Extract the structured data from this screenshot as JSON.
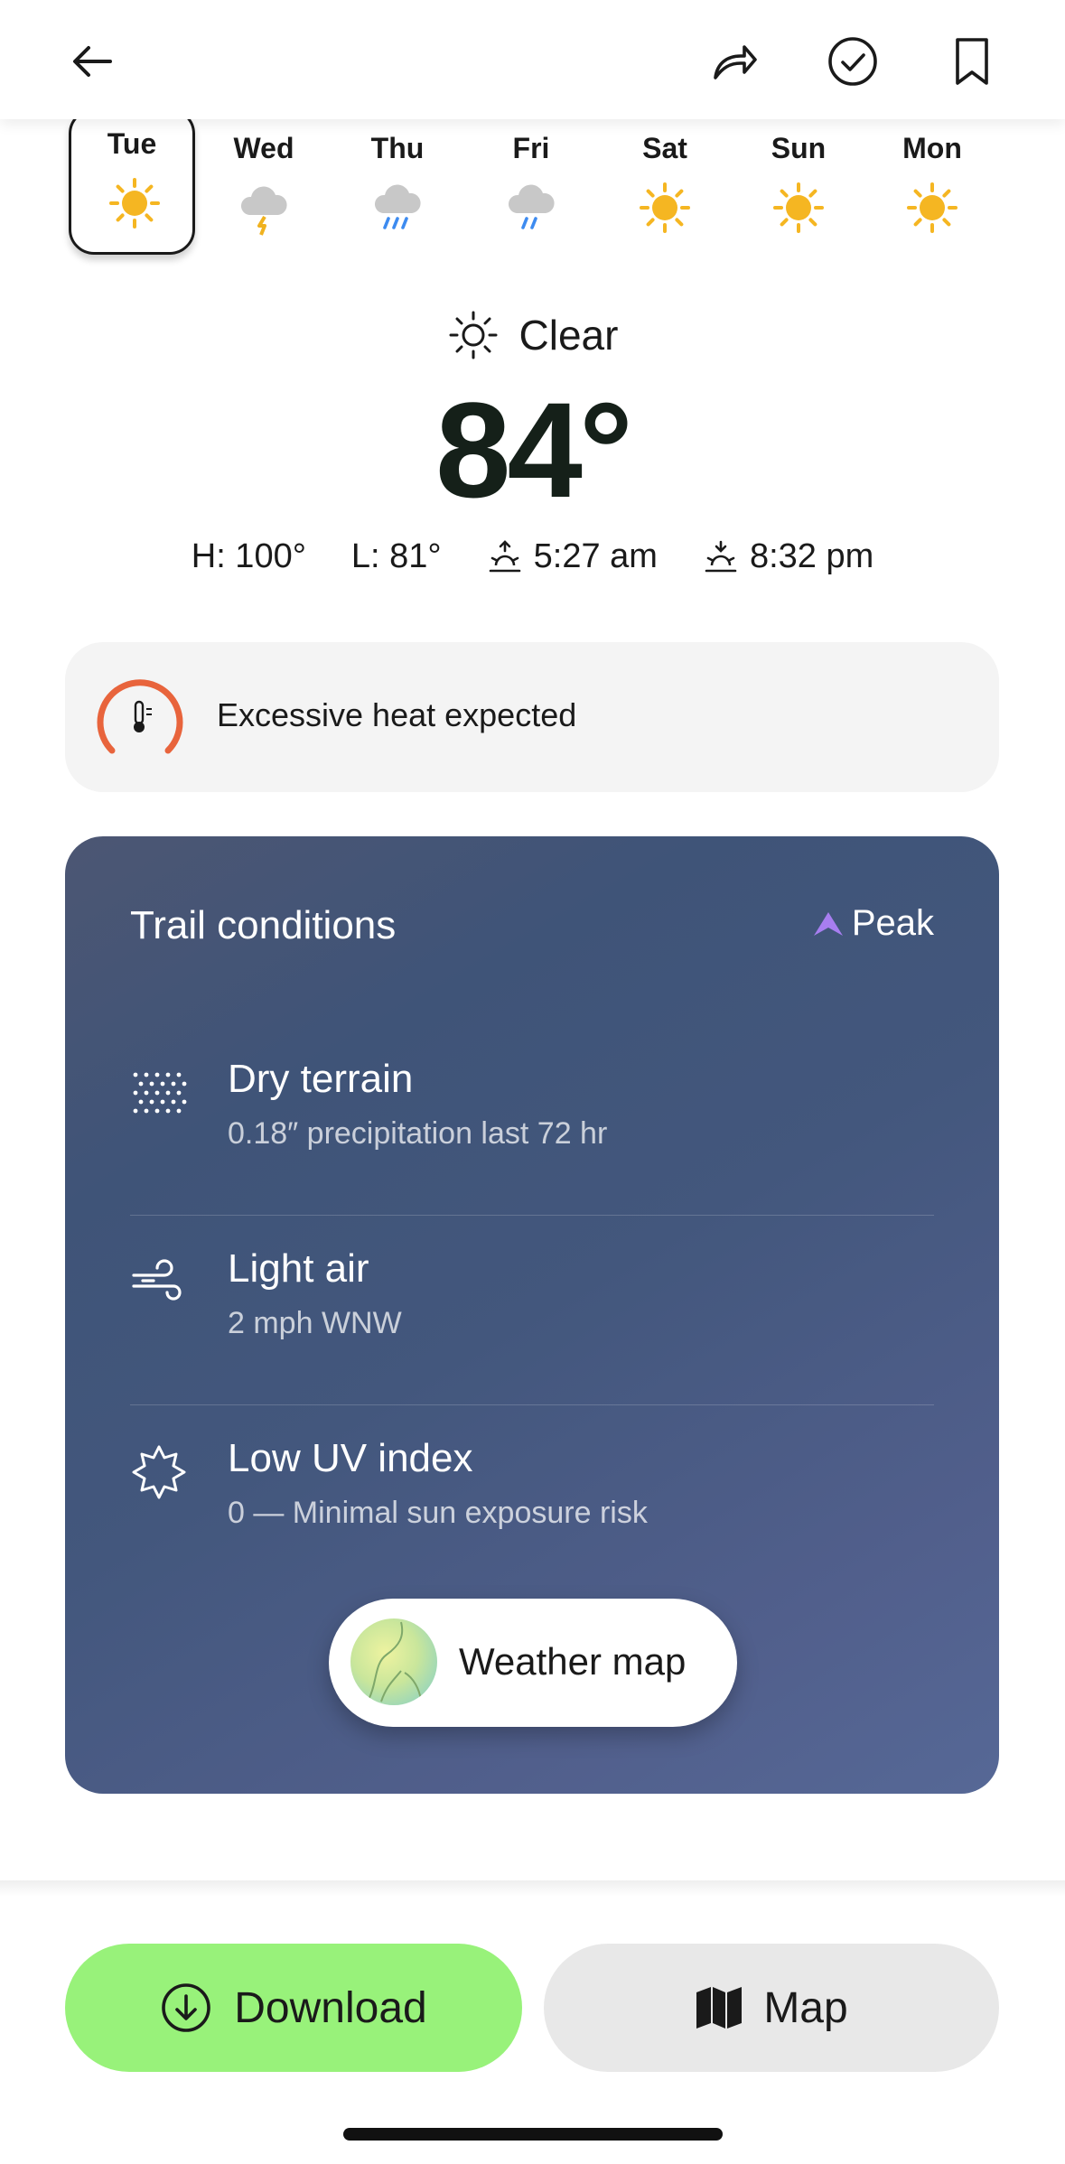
{
  "header": {
    "back_icon": "arrow-left-icon",
    "share_icon": "share-arrow-icon",
    "check_icon": "check-circle-icon",
    "bookmark_icon": "bookmark-icon"
  },
  "days": [
    {
      "label": "Tue",
      "icon": "sun-icon",
      "selected": true
    },
    {
      "label": "Wed",
      "icon": "thunderstorm-icon"
    },
    {
      "label": "Thu",
      "icon": "rain-icon"
    },
    {
      "label": "Fri",
      "icon": "rain-icon"
    },
    {
      "label": "Sat",
      "icon": "sun-icon"
    },
    {
      "label": "Sun",
      "icon": "sun-icon"
    },
    {
      "label": "Mon",
      "icon": "sun-icon"
    }
  ],
  "current": {
    "condition": "Clear",
    "temperature": "84°",
    "high": "H: 100°",
    "low": "L: 81°",
    "sunrise": "5:27 am",
    "sunset": "8:32 pm"
  },
  "alert": {
    "text": "Excessive heat expected",
    "color": "#e8643c"
  },
  "trail": {
    "title": "Trail conditions",
    "brand": "Peak",
    "brand_color": "#a77ef0",
    "items": [
      {
        "icon": "terrain-dots-icon",
        "title": "Dry terrain",
        "detail": "0.18″ precipitation last 72 hr"
      },
      {
        "icon": "wind-icon",
        "title": "Light air",
        "detail": "2 mph WNW"
      },
      {
        "icon": "uv-sun-icon",
        "title": "Low UV index",
        "detail": "0 — Minimal sun exposure risk"
      }
    ],
    "map_button": "Weather map"
  },
  "actions": {
    "download": "Download",
    "map": "Map",
    "download_color": "#98f27a"
  }
}
